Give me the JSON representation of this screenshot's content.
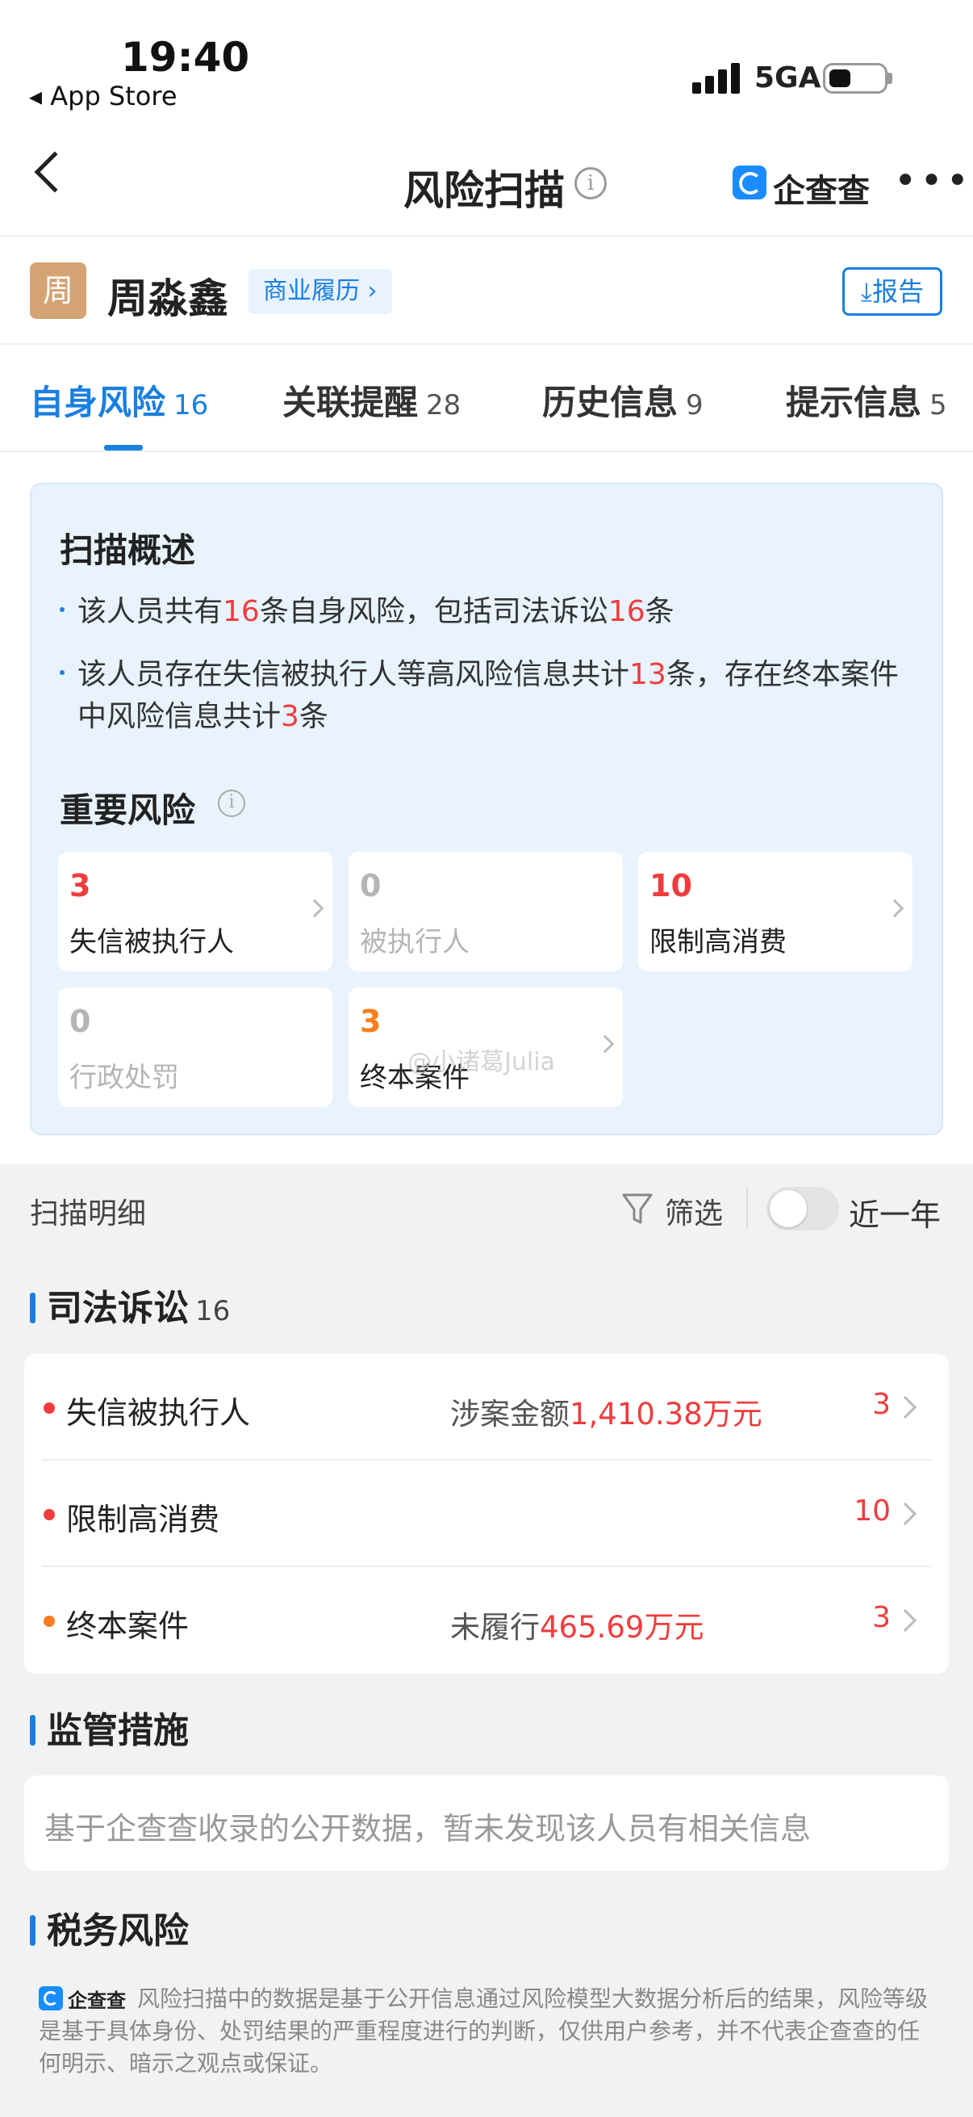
{
  "status_bar": {
    "time": "19:40",
    "back_app": "◂ App Store",
    "network": "5GA"
  },
  "nav": {
    "title": "风险扫描",
    "brand": "企查查",
    "more": "•••"
  },
  "person": {
    "avatar_char": "周",
    "name": "周淼鑫",
    "biz_tag": "商业履历 ›",
    "report_label": "⤓报告"
  },
  "tabs": [
    {
      "label": "自身风险",
      "count": "16"
    },
    {
      "label": "关联提醒",
      "count": "28"
    },
    {
      "label": "历史信息",
      "count": "9"
    },
    {
      "label": "提示信息",
      "count": "5"
    }
  ],
  "overview": {
    "title": "扫描概述",
    "line1": {
      "a": "该人员共有",
      "n1": "16",
      "b": "条自身风险，包括司法诉讼",
      "n2": "16",
      "c": "条"
    },
    "line2": {
      "a": "该人员存在失信被执行人等高风险信息共计",
      "n1": "13",
      "b": "条，存在终本案件中风险信息共计",
      "n2": "3",
      "c": "条"
    },
    "important_title": "重要风险",
    "risks": [
      {
        "count": "3",
        "label": "失信被执行人"
      },
      {
        "count": "0",
        "label": "被执行人"
      },
      {
        "count": "10",
        "label": "限制高消费"
      },
      {
        "count": "0",
        "label": "行政处罚"
      },
      {
        "count": "3",
        "label": "终本案件"
      }
    ],
    "watermark": "@小诸葛Julia"
  },
  "detail": {
    "title": "扫描明细",
    "filter_label": "筛选",
    "toggle_label": "近一年",
    "toggle_on": false
  },
  "sections": {
    "judicial": {
      "title": "司法诉讼",
      "count": "16",
      "rows": [
        {
          "label": "失信被执行人",
          "info_prefix": "涉案金额",
          "info_value": "1,410.38万元",
          "count": "3"
        },
        {
          "label": "限制高消费",
          "info_prefix": "",
          "info_value": "",
          "count": "10"
        },
        {
          "label": "终本案件",
          "info_prefix": "未履行",
          "info_value": "465.69万元",
          "count": "3"
        }
      ]
    },
    "supervision": {
      "title": "监管措施",
      "empty_text": "基于企查查收录的公开数据，暂未发现该人员有相关信息"
    },
    "tax": {
      "title": "税务风险"
    }
  },
  "footer": {
    "brand": "企查查",
    "text": "风险扫描中的数据是基于公开信息通过风险模型大数据分析后的结果，风险等级是基于具体身份、处罚结果的严重程度进行的判断，仅供用户参考，并不代表企查查的任何明示、暗示之观点或保证。"
  },
  "colors": {
    "accent": "#1a7fe0",
    "risk_red": "#f03c3c",
    "risk_orange": "#fa7d1e"
  }
}
